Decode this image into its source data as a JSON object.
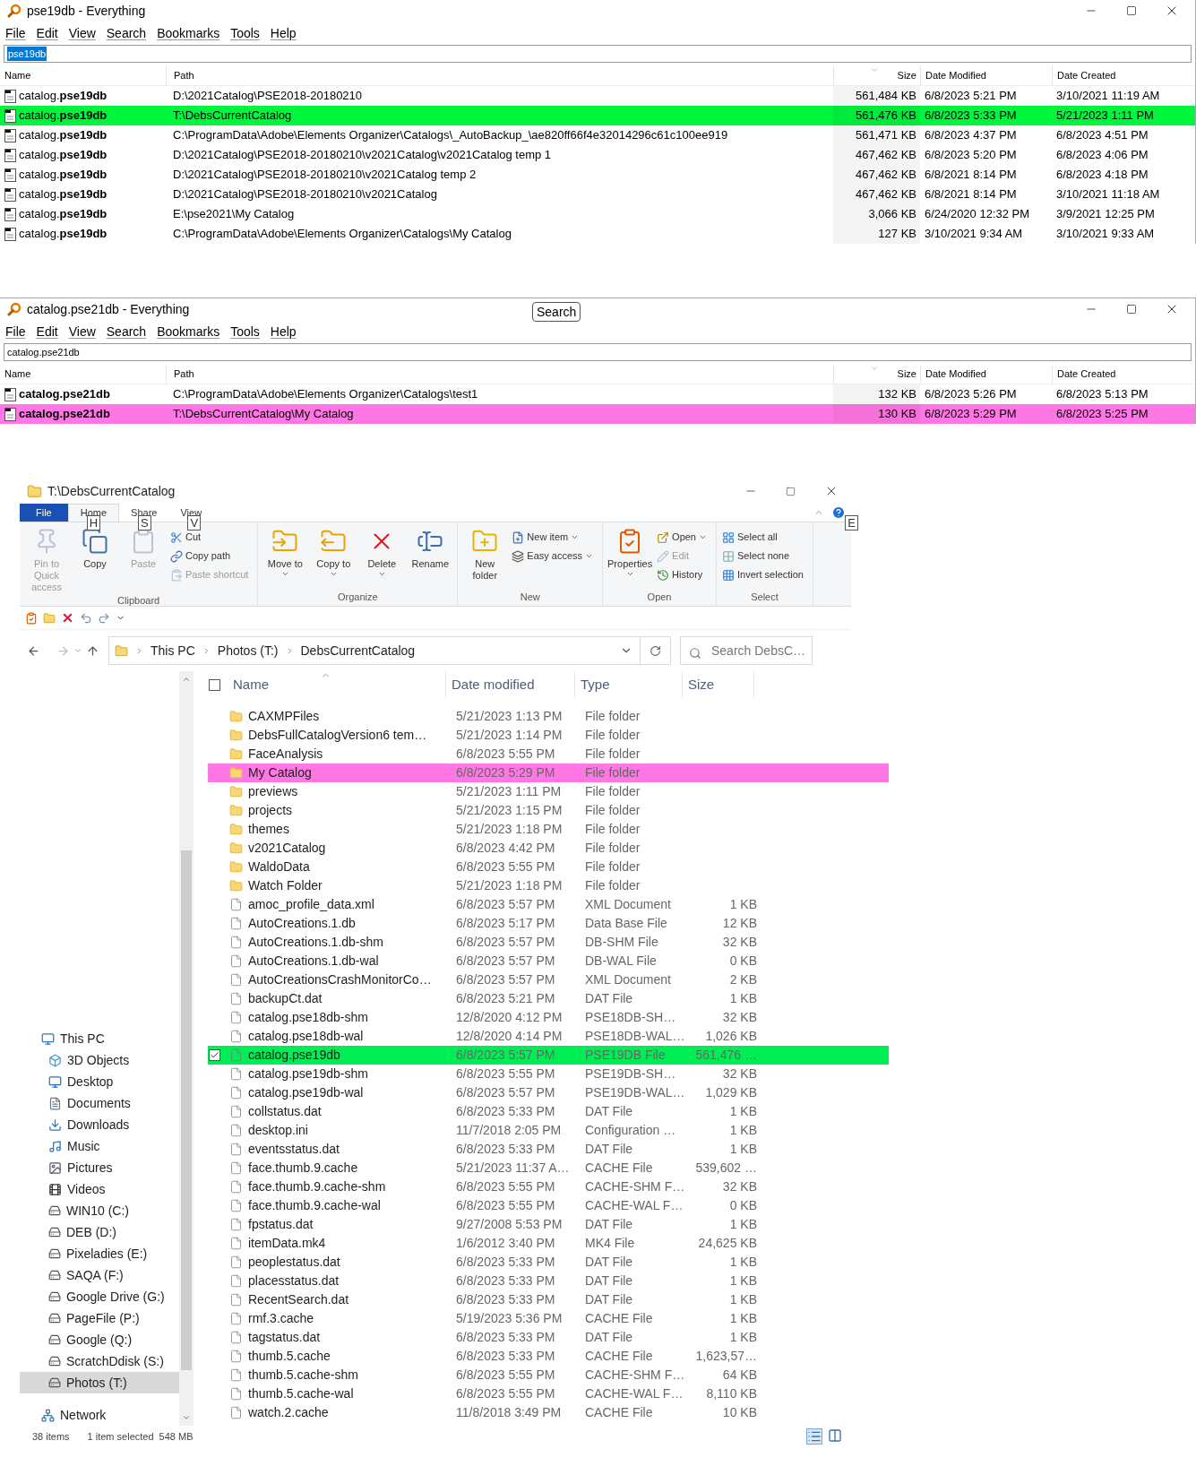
{
  "everything_windows": [
    {
      "title": "pse19db - Everything",
      "menu": [
        "File",
        "Edit",
        "View",
        "Search",
        "Bookmarks",
        "Tools",
        "Help"
      ],
      "query": "pse19db",
      "query_selected": true,
      "columns": [
        "Name",
        "Path",
        "Size",
        "Date Modified",
        "Date Created"
      ],
      "rows": [
        {
          "name": "catalog.**pse19db**",
          "path": "D:\\2021Catalog\\PSE2018-20180210",
          "size": "561,484 KB",
          "modified": "6/8/2023 5:21 PM",
          "created": "3/10/2021 11:19 AM",
          "color": "#ffffff"
        },
        {
          "name": "catalog.**pse19db**",
          "path": "T:\\DebsCurrentCatalog",
          "size": "561,476 KB",
          "modified": "6/8/2023 5:33 PM",
          "created": "5/21/2023 1:11 PM",
          "color": "#00f53d"
        },
        {
          "name": "catalog.**pse19db**",
          "path": "C:\\ProgramData\\Adobe\\Elements Organizer\\Catalogs\\_AutoBackup_\\ae820ff66f4e32014296c61c100ee919",
          "size": "561,471 KB",
          "modified": "6/8/2023 4:37 PM",
          "created": "6/8/2023 4:51 PM",
          "color": "#ffffff"
        },
        {
          "name": "catalog.**pse19db**",
          "path": "D:\\2021Catalog\\PSE2018-20180210\\v2021Catalog\\v2021Catalog temp 1",
          "size": "467,462 KB",
          "modified": "6/8/2023 5:20 PM",
          "created": "6/8/2023 4:06 PM",
          "color": "#ffffff"
        },
        {
          "name": "catalog.**pse19db**",
          "path": "D:\\2021Catalog\\PSE2018-20180210\\v2021Catalog temp 2",
          "size": "467,462 KB",
          "modified": "6/8/2021 8:14 PM",
          "created": "6/8/2023 4:18 PM",
          "color": "#ffffff"
        },
        {
          "name": "catalog.**pse19db**",
          "path": "D:\\2021Catalog\\PSE2018-20180210\\v2021Catalog",
          "size": "467,462 KB",
          "modified": "6/8/2021 8:14 PM",
          "created": "3/10/2021 11:18 AM",
          "color": "#ffffff"
        },
        {
          "name": "catalog.**pse19db**",
          "path": "E:\\pse2021\\My Catalog",
          "size": "3,066 KB",
          "modified": "6/24/2020 12:32 PM",
          "created": "3/9/2021 12:25 PM",
          "color": "#ffffff"
        },
        {
          "name": "catalog.**pse19db**",
          "path": "C:\\ProgramData\\Adobe\\Elements Organizer\\Catalogs\\My Catalog",
          "size": "127 KB",
          "modified": "3/10/2021 9:34 AM",
          "created": "3/10/2021 9:33 AM",
          "color": "#ffffff"
        }
      ]
    },
    {
      "title": "catalog.pse21db - Everything",
      "title_button": "Search",
      "menu": [
        "File",
        "Edit",
        "View",
        "Search",
        "Bookmarks",
        "Tools",
        "Help"
      ],
      "query": "catalog.pse21db",
      "query_selected": false,
      "columns": [
        "Name",
        "Path",
        "Size",
        "Date Modified",
        "Date Created"
      ],
      "rows": [
        {
          "name": "**catalog.pse21db**",
          "path": "C:\\ProgramData\\Adobe\\Elements Organizer\\Catalogs\\test1",
          "size": "132 KB",
          "modified": "6/8/2023 5:26 PM",
          "created": "6/8/2023 5:13 PM",
          "color": "#ffffff"
        },
        {
          "name": "**catalog.pse21db**",
          "path": "T:\\DebsCurrentCatalog\\My Catalog",
          "size": "130 KB",
          "modified": "6/8/2023 5:29 PM",
          "created": "6/8/2023 5:25 PM",
          "color": "#ff77e4"
        }
      ]
    }
  ],
  "explorer": {
    "title": "T:\\DebsCurrentCatalog",
    "ribbon_tabs": [
      {
        "label": "File",
        "kind": "file",
        "selected": false
      },
      {
        "label": "Home",
        "kind": "tab",
        "selected": true,
        "keytip": "H"
      },
      {
        "label": "Share",
        "kind": "tab",
        "selected": false,
        "keytip": "S"
      },
      {
        "label": "View",
        "kind": "tab",
        "selected": false,
        "keytip": "V"
      }
    ],
    "help_keytip": "E",
    "ribbon_groups": [
      {
        "label": "Clipboard",
        "items": [
          {
            "label": "Pin to Quick access",
            "kind": "large",
            "disabled": true,
            "has_menu": false
          },
          {
            "label": "Copy",
            "kind": "large",
            "disabled": false,
            "has_menu": false
          },
          {
            "label": "Paste",
            "kind": "large",
            "disabled": true,
            "has_menu": false
          },
          {
            "label": "Cut",
            "kind": "small",
            "disabled": false,
            "has_menu": false
          },
          {
            "label": "Copy path",
            "kind": "small",
            "disabled": false,
            "has_menu": false
          },
          {
            "label": "Paste shortcut",
            "kind": "small",
            "disabled": true,
            "has_menu": false
          }
        ]
      },
      {
        "label": "Organize",
        "items": [
          {
            "label": "Move to",
            "kind": "large",
            "disabled": false,
            "has_menu": true
          },
          {
            "label": "Copy to",
            "kind": "large",
            "disabled": false,
            "has_menu": true
          },
          {
            "label": "Delete",
            "kind": "large",
            "disabled": false,
            "has_menu": true
          },
          {
            "label": "Rename",
            "kind": "large",
            "disabled": false,
            "has_menu": false
          }
        ]
      },
      {
        "label": "New",
        "items": [
          {
            "label": "New folder",
            "kind": "large",
            "disabled": false,
            "has_menu": false
          },
          {
            "label": "New item",
            "kind": "small",
            "disabled": false,
            "has_menu": true
          },
          {
            "label": "Easy access",
            "kind": "small",
            "disabled": false,
            "has_menu": true
          }
        ]
      },
      {
        "label": "Open",
        "items": [
          {
            "label": "Properties",
            "kind": "large",
            "disabled": false,
            "has_menu": true
          },
          {
            "label": "Open",
            "kind": "small",
            "disabled": false,
            "has_menu": true
          },
          {
            "label": "Edit",
            "kind": "small",
            "disabled": true,
            "has_menu": false
          },
          {
            "label": "History",
            "kind": "small",
            "disabled": false,
            "has_menu": false
          }
        ]
      },
      {
        "label": "Select",
        "items": [
          {
            "label": "Select all",
            "kind": "small",
            "disabled": false,
            "has_menu": false
          },
          {
            "label": "Select none",
            "kind": "small",
            "disabled": false,
            "has_menu": false
          },
          {
            "label": "Invert selection",
            "kind": "small",
            "disabled": false,
            "has_menu": false
          }
        ]
      }
    ],
    "breadcrumbs": [
      "This PC",
      "Photos (T:)",
      "DebsCurrentCatalog"
    ],
    "search": {
      "placeholder": "Search DebsC…"
    },
    "columns": [
      "Name",
      "Date modified",
      "Type",
      "Size"
    ],
    "select_all_checked": false,
    "rows": [
      {
        "name": "CAXMPFiles",
        "date": "5/21/2023 1:13 PM",
        "type": "File folder",
        "kind": "folder",
        "checked": false,
        "color": "#ffffff"
      },
      {
        "name": "DebsFullCatalogVersion6 tem…",
        "date": "5/21/2023 1:14 PM",
        "type": "File folder",
        "kind": "folder",
        "checked": false,
        "color": "#ffffff"
      },
      {
        "name": "FaceAnalysis",
        "date": "6/8/2023 5:55 PM",
        "type": "File folder",
        "kind": "folder",
        "checked": false,
        "color": "#ffffff"
      },
      {
        "name": "My Catalog",
        "date": "6/8/2023 5:29 PM",
        "type": "File folder",
        "kind": "folder",
        "checked": false,
        "color": "#ff77e4"
      },
      {
        "name": "previews",
        "date": "5/21/2023 1:11 PM",
        "type": "File folder",
        "kind": "folder",
        "checked": false,
        "color": "#ffffff"
      },
      {
        "name": "projects",
        "date": "5/21/2023 1:15 PM",
        "type": "File folder",
        "kind": "folder",
        "checked": false,
        "color": "#ffffff"
      },
      {
        "name": "themes",
        "date": "5/21/2023 1:18 PM",
        "type": "File folder",
        "kind": "folder",
        "checked": false,
        "color": "#ffffff"
      },
      {
        "name": "v2021Catalog",
        "date": "6/8/2023 4:42 PM",
        "type": "File folder",
        "kind": "folder",
        "checked": false,
        "color": "#ffffff"
      },
      {
        "name": "WaldoData",
        "date": "6/8/2023 5:55 PM",
        "type": "File folder",
        "kind": "folder",
        "checked": false,
        "color": "#ffffff"
      },
      {
        "name": "Watch Folder",
        "date": "5/21/2023 1:18 PM",
        "type": "File folder",
        "kind": "folder",
        "checked": false,
        "color": "#ffffff"
      },
      {
        "name": "amoc_profile_data.xml",
        "date": "6/8/2023 5:57 PM",
        "type": "XML Document",
        "size": "1 KB",
        "kind": "file",
        "checked": false,
        "color": "#ffffff"
      },
      {
        "name": "AutoCreations.1.db",
        "date": "6/8/2023 5:17 PM",
        "type": "Data Base File",
        "size": "12 KB",
        "kind": "file",
        "checked": false,
        "color": "#ffffff"
      },
      {
        "name": "AutoCreations.1.db-shm",
        "date": "6/8/2023 5:57 PM",
        "type": "DB-SHM File",
        "size": "32 KB",
        "kind": "file",
        "checked": false,
        "color": "#ffffff"
      },
      {
        "name": "AutoCreations.1.db-wal",
        "date": "6/8/2023 5:57 PM",
        "type": "DB-WAL File",
        "size": "0 KB",
        "kind": "file",
        "checked": false,
        "color": "#ffffff"
      },
      {
        "name": "AutoCreationsCrashMonitorCo…",
        "date": "6/8/2023 5:57 PM",
        "type": "XML Document",
        "size": "2 KB",
        "kind": "file",
        "checked": false,
        "color": "#ffffff"
      },
      {
        "name": "backupCt.dat",
        "date": "6/8/2023 5:21 PM",
        "type": "DAT File",
        "size": "1 KB",
        "kind": "file",
        "checked": false,
        "color": "#ffffff"
      },
      {
        "name": "catalog.pse18db-shm",
        "date": "12/8/2020 4:12 PM",
        "type": "PSE18DB-SH…",
        "size": "32 KB",
        "kind": "file",
        "checked": false,
        "color": "#ffffff"
      },
      {
        "name": "catalog.pse18db-wal",
        "date": "12/8/2020 4:14 PM",
        "type": "PSE18DB-WAL…",
        "size": "1,026 KB",
        "kind": "file",
        "checked": false,
        "color": "#ffffff"
      },
      {
        "name": "catalog.pse19db",
        "date": "6/8/2023 5:57 PM",
        "type": "PSE19DB File",
        "size": "561,476 …",
        "kind": "file",
        "checked": true,
        "color": "#00ee55"
      },
      {
        "name": "catalog.pse19db-shm",
        "date": "6/8/2023 5:55 PM",
        "type": "PSE19DB-SH…",
        "size": "32 KB",
        "kind": "file",
        "checked": false,
        "color": "#ffffff"
      },
      {
        "name": "catalog.pse19db-wal",
        "date": "6/8/2023 5:57 PM",
        "type": "PSE19DB-WAL…",
        "size": "1,029 KB",
        "kind": "file",
        "checked": false,
        "color": "#ffffff"
      },
      {
        "name": "collstatus.dat",
        "date": "6/8/2023 5:33 PM",
        "type": "DAT File",
        "size": "1 KB",
        "kind": "file",
        "checked": false,
        "color": "#ffffff"
      },
      {
        "name": "desktop.ini",
        "date": "11/7/2018 2:05 PM",
        "type": "Configuration …",
        "size": "1 KB",
        "kind": "file",
        "checked": false,
        "color": "#ffffff"
      },
      {
        "name": "eventsstatus.dat",
        "date": "6/8/2023 5:33 PM",
        "type": "DAT File",
        "size": "1 KB",
        "kind": "file",
        "checked": false,
        "color": "#ffffff"
      },
      {
        "name": "face.thumb.9.cache",
        "date": "5/21/2023 11:37 A…",
        "type": "CACHE File",
        "size": "539,602 …",
        "kind": "file",
        "checked": false,
        "color": "#ffffff"
      },
      {
        "name": "face.thumb.9.cache-shm",
        "date": "6/8/2023 5:55 PM",
        "type": "CACHE-SHM F…",
        "size": "32 KB",
        "kind": "file",
        "checked": false,
        "color": "#ffffff"
      },
      {
        "name": "face.thumb.9.cache-wal",
        "date": "6/8/2023 5:55 PM",
        "type": "CACHE-WAL F…",
        "size": "0 KB",
        "kind": "file",
        "checked": false,
        "color": "#ffffff"
      },
      {
        "name": "fpstatus.dat",
        "date": "9/27/2008 5:53 PM",
        "type": "DAT File",
        "size": "1 KB",
        "kind": "file",
        "checked": false,
        "color": "#ffffff"
      },
      {
        "name": "itemData.mk4",
        "date": "1/6/2012 3:40 PM",
        "type": "MK4 File",
        "size": "24,625 KB",
        "kind": "file",
        "checked": false,
        "color": "#ffffff"
      },
      {
        "name": "peoplestatus.dat",
        "date": "6/8/2023 5:33 PM",
        "type": "DAT File",
        "size": "1 KB",
        "kind": "file",
        "checked": false,
        "color": "#ffffff"
      },
      {
        "name": "placesstatus.dat",
        "date": "6/8/2023 5:33 PM",
        "type": "DAT File",
        "size": "1 KB",
        "kind": "file",
        "checked": false,
        "color": "#ffffff"
      },
      {
        "name": "RecentSearch.dat",
        "date": "6/8/2023 5:33 PM",
        "type": "DAT File",
        "size": "1 KB",
        "kind": "file",
        "checked": false,
        "color": "#ffffff"
      },
      {
        "name": "rmf.3.cache",
        "date": "5/19/2023 5:36 PM",
        "type": "CACHE File",
        "size": "1 KB",
        "kind": "file",
        "checked": false,
        "color": "#ffffff"
      },
      {
        "name": "tagstatus.dat",
        "date": "6/8/2023 5:33 PM",
        "type": "DAT File",
        "size": "1 KB",
        "kind": "file",
        "checked": false,
        "color": "#ffffff"
      },
      {
        "name": "thumb.5.cache",
        "date": "6/8/2023 5:33 PM",
        "type": "CACHE File",
        "size": "1,623,57…",
        "kind": "file",
        "checked": false,
        "color": "#ffffff"
      },
      {
        "name": "thumb.5.cache-shm",
        "date": "6/8/2023 5:55 PM",
        "type": "CACHE-SHM F…",
        "size": "64 KB",
        "kind": "file",
        "checked": false,
        "color": "#ffffff"
      },
      {
        "name": "thumb.5.cache-wal",
        "date": "6/8/2023 5:55 PM",
        "type": "CACHE-WAL F…",
        "size": "8,110 KB",
        "kind": "file",
        "checked": false,
        "color": "#ffffff"
      },
      {
        "name": "watch.2.cache",
        "date": "11/8/2018 3:49 PM",
        "type": "CACHE File",
        "size": "10 KB",
        "kind": "file",
        "checked": false,
        "color": "#ffffff"
      }
    ],
    "nav": [
      {
        "label": "This PC",
        "kind": "pc",
        "selected": false,
        "children": [
          {
            "label": "3D Objects",
            "kind": "cube",
            "selected": false
          },
          {
            "label": "Desktop",
            "kind": "desktop",
            "selected": false
          },
          {
            "label": "Documents",
            "kind": "documents",
            "selected": false
          },
          {
            "label": "Downloads",
            "kind": "downloads",
            "selected": false
          },
          {
            "label": "Music",
            "kind": "music",
            "selected": false
          },
          {
            "label": "Pictures",
            "kind": "pictures",
            "selected": false
          },
          {
            "label": "Videos",
            "kind": "videos",
            "selected": false
          },
          {
            "label": "WIN10 (C:)",
            "kind": "drive",
            "selected": false
          },
          {
            "label": "DEB (D:)",
            "kind": "drive",
            "selected": false
          },
          {
            "label": "Pixeladies (E:)",
            "kind": "drive",
            "selected": false
          },
          {
            "label": "SAQA (F:)",
            "kind": "drive",
            "selected": false
          },
          {
            "label": "Google Drive (G:)",
            "kind": "drive",
            "selected": false
          },
          {
            "label": "PageFile (P:)",
            "kind": "drive",
            "selected": false
          },
          {
            "label": "Google (Q:)",
            "kind": "drive",
            "selected": false
          },
          {
            "label": "ScratchDdisk (S:)",
            "kind": "drive",
            "selected": false
          },
          {
            "label": "Photos (T:)",
            "kind": "drive",
            "selected": true
          }
        ]
      },
      {
        "label": "Network",
        "kind": "network",
        "selected": false
      }
    ],
    "status": {
      "count": "38 items",
      "selection": "1 item selected",
      "size": "548 MB"
    }
  }
}
